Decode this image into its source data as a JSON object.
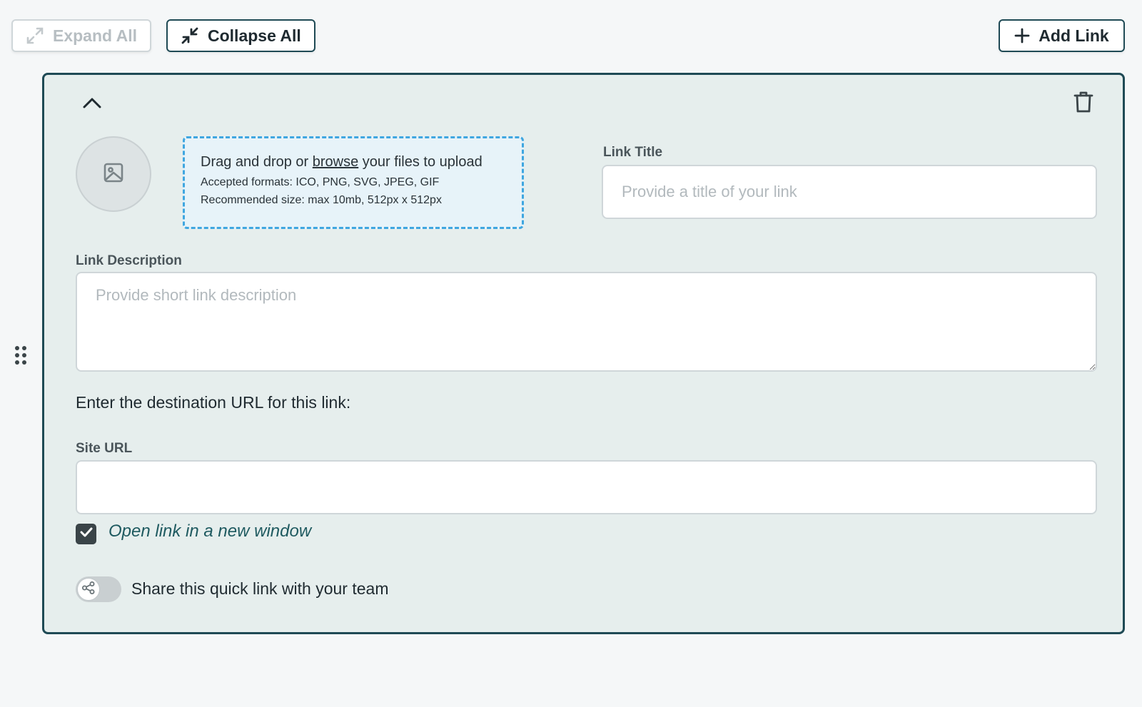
{
  "toolbar": {
    "expand_all_label": "Expand All",
    "collapse_all_label": "Collapse All",
    "add_link_label": "Add Link"
  },
  "upload": {
    "drag_text_before": "Drag and drop or ",
    "browse_text": "browse",
    "drag_text_after": " your files to upload",
    "formats": "Accepted formats: ICO, PNG, SVG, JPEG, GIF",
    "size": "Recommended size: max 10mb, 512px x 512px"
  },
  "link_title": {
    "label": "Link Title",
    "placeholder": "Provide a title of your link",
    "value": ""
  },
  "link_description": {
    "label": "Link Description",
    "placeholder": "Provide short link description",
    "value": ""
  },
  "destination_prompt": "Enter the destination URL for this link:",
  "site_url": {
    "label": "Site URL",
    "value": ""
  },
  "new_window": {
    "label": "Open link in a new window",
    "checked": true
  },
  "share": {
    "label": "Share this quick link with your team",
    "enabled": false
  },
  "colors": {
    "accent": "#1f4a55",
    "dropzone_border": "#3fa6e0",
    "card_bg": "#e6eeed"
  },
  "icons": {
    "expand": "expand-arrows-icon",
    "collapse": "collapse-arrows-icon",
    "add": "plus-icon",
    "drag": "drag-dots-icon",
    "chevron": "chevron-up-icon",
    "delete": "trash-icon",
    "image": "image-icon",
    "check": "check-icon",
    "share": "share-icon"
  }
}
